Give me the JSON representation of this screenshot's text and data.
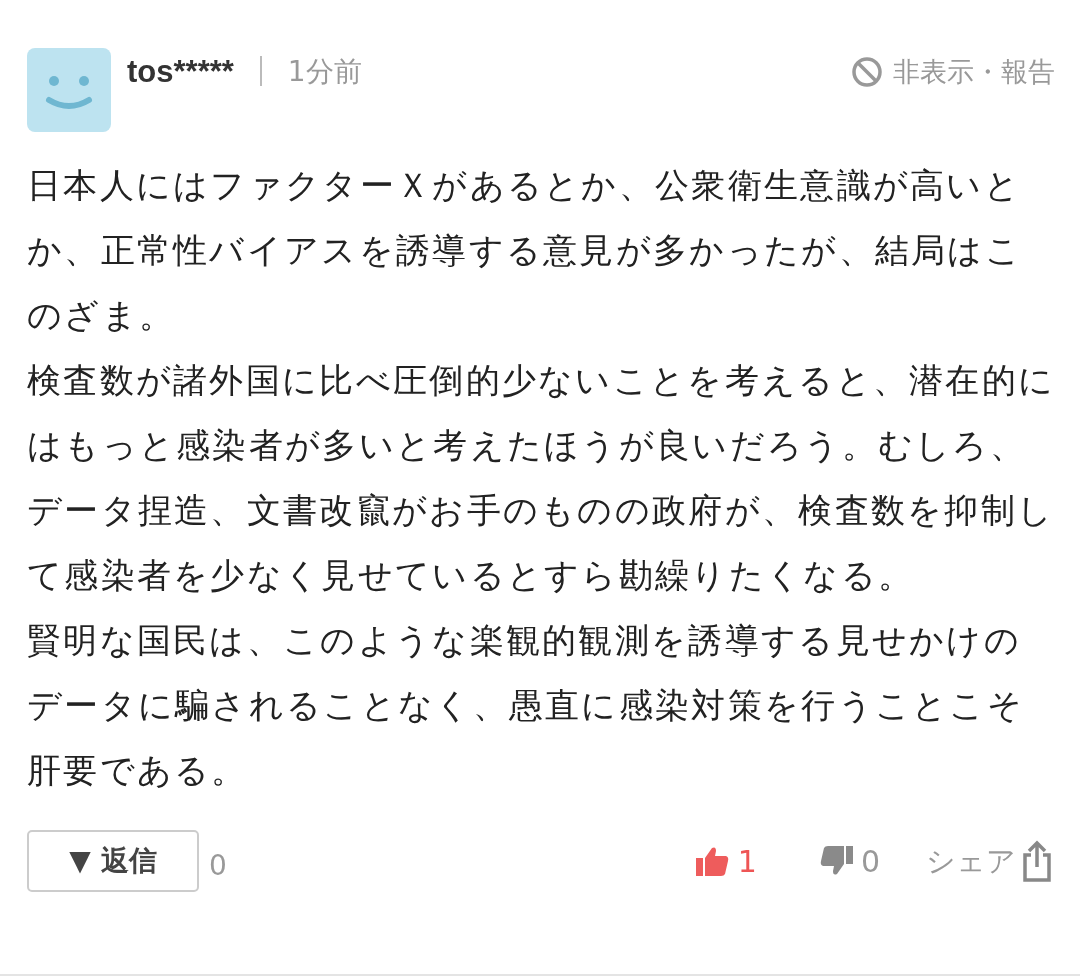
{
  "comment": {
    "user": "tos*****",
    "time": "1分前",
    "hide_report": "非表示・報告",
    "paragraphs": [
      "日本人にはファクターＸがあるとか、公衆衛生意識が高いとか、正常性バイアスを誘導する意見が多かったが、結局はこのざま。",
      "検査数が諸外国に比べ圧倒的少ないことを考えると、潜在的にはもっと感染者が多いと考えたほうが良いだろう。むしろ、データ捏造、文書改竄がお手のものの政府が、検査数を抑制して感染者を少なく見せているとすら勘繰りたくなる。",
      "賢明な国民は、このような楽観的観測を誘導する見せかけのデータに騙されることなく、愚直に感染対策を行うことこそ肝要である。"
    ],
    "reply_button": "▼ 返信",
    "reply_count": "0",
    "likes": "1",
    "dislikes": "0",
    "share": "シェア"
  }
}
